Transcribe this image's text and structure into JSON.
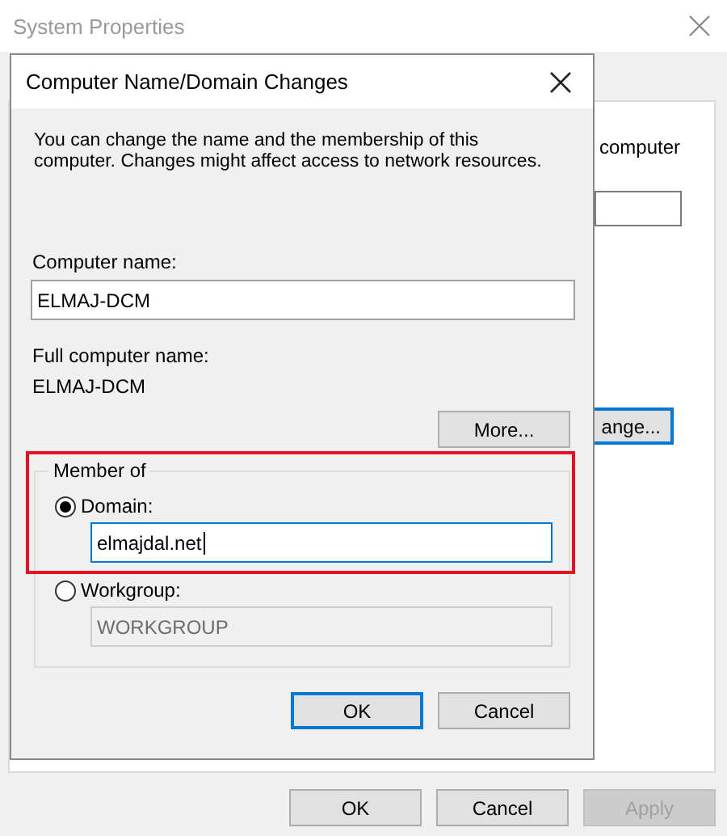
{
  "background_window": {
    "title": "System Properties",
    "partial_text": "computer",
    "partial_button": "ange...",
    "buttons": [
      {
        "label": "OK",
        "disabled": false
      },
      {
        "label": "Cancel",
        "disabled": false
      },
      {
        "label": "Apply",
        "disabled": true
      }
    ]
  },
  "dialog": {
    "title": "Computer Name/Domain Changes",
    "description": "You can change the name and the membership of this computer. Changes might affect access to network resources.",
    "computer_name": {
      "label": "Computer name:",
      "value": "ELMAJ-DCM"
    },
    "full_name": {
      "label": "Full computer name:",
      "value": "ELMAJ-DCM"
    },
    "more_button": "More...",
    "member_of": {
      "title": "Member of",
      "options": [
        {
          "label": "Domain:",
          "selected": true,
          "value": "elmajdal.net"
        },
        {
          "label": "Workgroup:",
          "selected": false,
          "value": "WORKGROUP"
        }
      ]
    },
    "buttons": [
      {
        "label": "OK",
        "default": true
      },
      {
        "label": "Cancel",
        "default": false
      }
    ]
  }
}
